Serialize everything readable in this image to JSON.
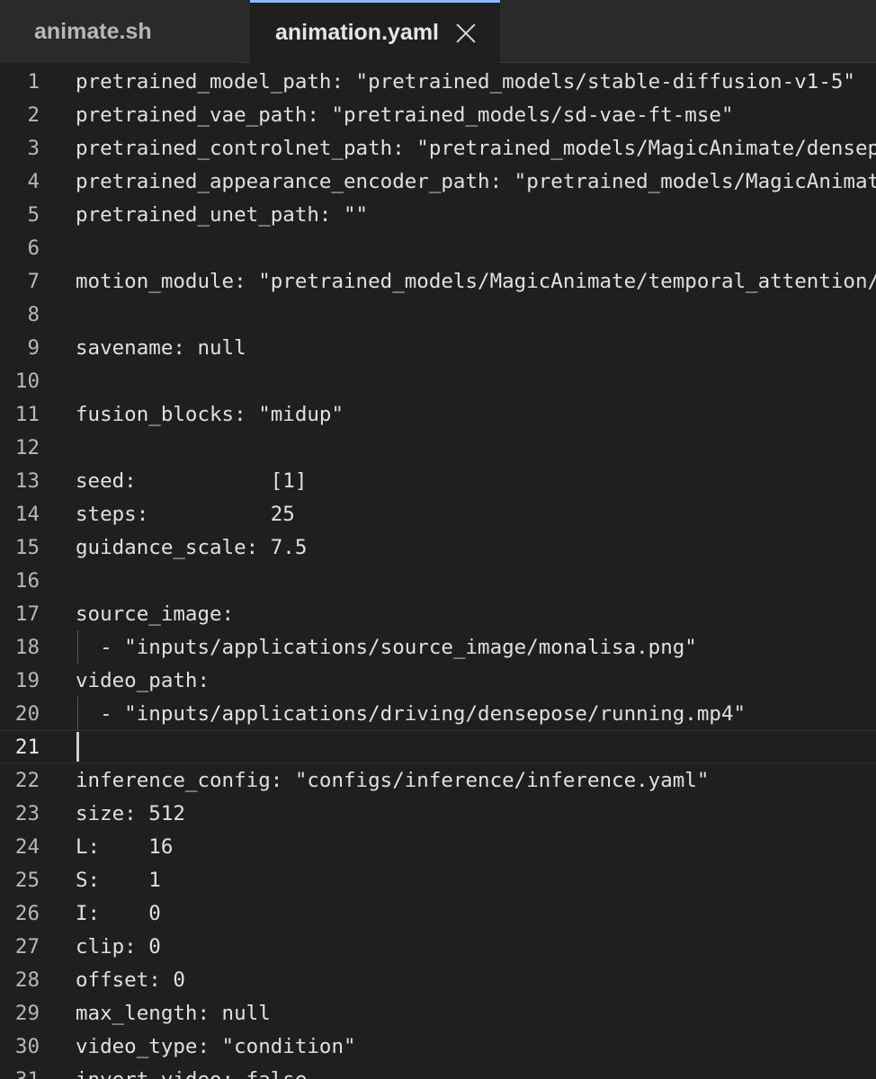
{
  "tabs": [
    {
      "label": "animate.sh",
      "active": false
    },
    {
      "label": "animation.yaml",
      "active": true
    }
  ],
  "colors": {
    "tab_active_indicator": "#8fb8ff",
    "editor_background": "#1f1f1f"
  },
  "editor": {
    "current_line": 21,
    "lines": [
      {
        "n": "1",
        "text": "pretrained_model_path: \"pretrained_models/stable-diffusion-v1-5\""
      },
      {
        "n": "2",
        "text": "pretrained_vae_path: \"pretrained_models/sd-vae-ft-mse\""
      },
      {
        "n": "3",
        "text": "pretrained_controlnet_path: \"pretrained_models/MagicAnimate/densepose_controlnet\""
      },
      {
        "n": "4",
        "text": "pretrained_appearance_encoder_path: \"pretrained_models/MagicAnimate/appearance_encoder\""
      },
      {
        "n": "5",
        "text": "pretrained_unet_path: \"\""
      },
      {
        "n": "6",
        "text": ""
      },
      {
        "n": "7",
        "text": "motion_module: \"pretrained_models/MagicAnimate/temporal_attention/temporal_attention.ckpt\""
      },
      {
        "n": "8",
        "text": ""
      },
      {
        "n": "9",
        "text": "savename: null"
      },
      {
        "n": "10",
        "text": ""
      },
      {
        "n": "11",
        "text": "fusion_blocks: \"midup\""
      },
      {
        "n": "12",
        "text": ""
      },
      {
        "n": "13",
        "text": "seed:           [1]"
      },
      {
        "n": "14",
        "text": "steps:          25"
      },
      {
        "n": "15",
        "text": "guidance_scale: 7.5"
      },
      {
        "n": "16",
        "text": ""
      },
      {
        "n": "17",
        "text": "source_image:"
      },
      {
        "n": "18",
        "text": "  - \"inputs/applications/source_image/monalisa.png\""
      },
      {
        "n": "19",
        "text": "video_path:"
      },
      {
        "n": "20",
        "text": "  - \"inputs/applications/driving/densepose/running.mp4\""
      },
      {
        "n": "21",
        "text": ""
      },
      {
        "n": "22",
        "text": "inference_config: \"configs/inference/inference.yaml\""
      },
      {
        "n": "23",
        "text": "size: 512"
      },
      {
        "n": "24",
        "text": "L:    16"
      },
      {
        "n": "25",
        "text": "S:    1"
      },
      {
        "n": "26",
        "text": "I:    0"
      },
      {
        "n": "27",
        "text": "clip: 0"
      },
      {
        "n": "28",
        "text": "offset: 0"
      },
      {
        "n": "29",
        "text": "max_length: null"
      },
      {
        "n": "30",
        "text": "video_type: \"condition\""
      },
      {
        "n": "31",
        "text": "invert_video: false"
      }
    ]
  }
}
